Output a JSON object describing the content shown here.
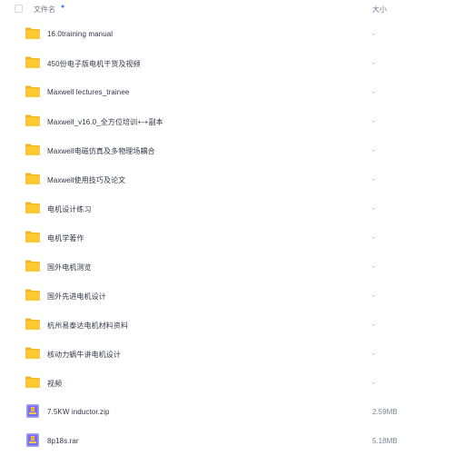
{
  "header": {
    "name_label": "文件名",
    "size_label": "大小"
  },
  "files": [
    {
      "name": "16.0training manual",
      "size": "-",
      "type": "folder"
    },
    {
      "name": "450份电子版电机干货及视频",
      "size": "-",
      "type": "folder"
    },
    {
      "name": "Maxwell lectures_trainee",
      "size": "-",
      "type": "folder"
    },
    {
      "name": "Maxwell_v16.0_全方位培训+-+副本",
      "size": "-",
      "type": "folder"
    },
    {
      "name": "Maxwell电磁仿真及多物理场耦合",
      "size": "-",
      "type": "folder"
    },
    {
      "name": "Maxwell使用技巧及论文",
      "size": "-",
      "type": "folder"
    },
    {
      "name": "电机设计练习",
      "size": "-",
      "type": "folder"
    },
    {
      "name": "电机学著作",
      "size": "-",
      "type": "folder"
    },
    {
      "name": "国外电机测览",
      "size": "-",
      "type": "folder"
    },
    {
      "name": "国外先进电机设计",
      "size": "-",
      "type": "folder"
    },
    {
      "name": "杭州易泰达电机材料资料",
      "size": "-",
      "type": "folder"
    },
    {
      "name": "核动力蜗牛讲电机设计",
      "size": "-",
      "type": "folder"
    },
    {
      "name": "视频",
      "size": "-",
      "type": "folder"
    },
    {
      "name": "7.5KW inductor.zip",
      "size": "2.59MB",
      "type": "archive"
    },
    {
      "name": "8p18s.rar",
      "size": "5.18MB",
      "type": "archive"
    }
  ],
  "colors": {
    "folder": "#fcc934",
    "folder_back": "#f5b324",
    "archive": "#7a6cf0",
    "accent": "#3d7bf5"
  },
  "icons": {
    "folder": "folder-icon",
    "archive": "archive-icon",
    "sort": "sort-icon"
  }
}
